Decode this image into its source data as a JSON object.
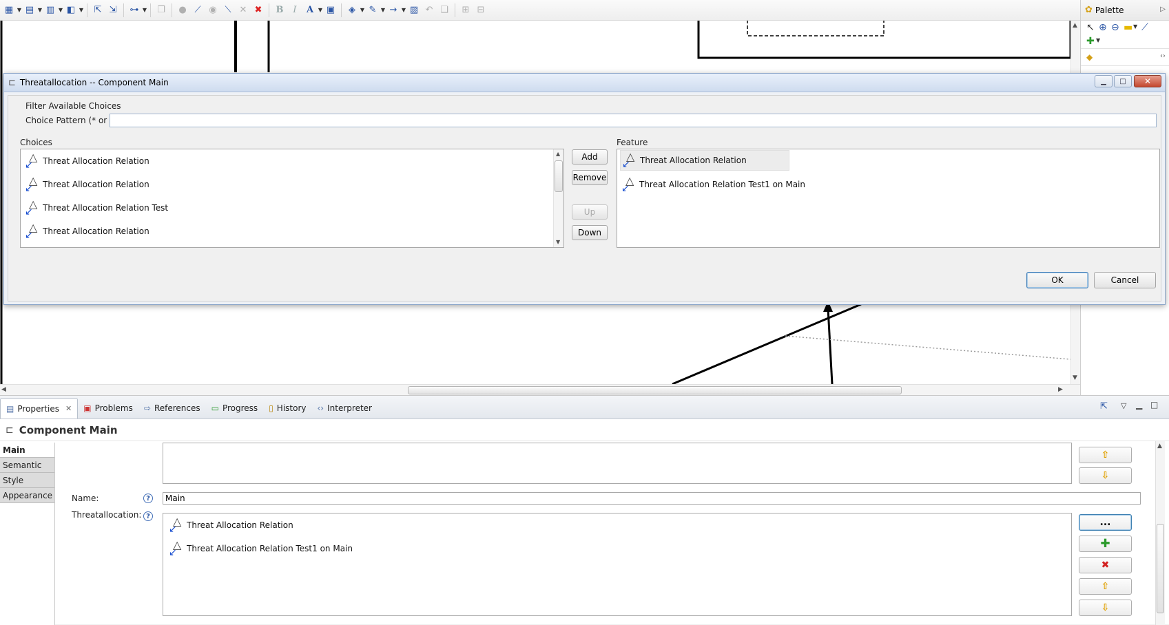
{
  "toolbar": {
    "icons": [
      "align-icon",
      "arrange-icon",
      "distribute-icon",
      "layout-icon",
      "navigate-icon",
      "select-all-icon",
      "route-icon",
      "copy-format-icon",
      "dot-icon",
      "pin-icon",
      "label-icon",
      "label-icon-2",
      "delete-icon",
      "delete-from-model-icon",
      "bold-icon",
      "italic-icon",
      "font-color-icon",
      "text-style-icon",
      "fill-color-icon",
      "line-color-icon",
      "line-style-icon",
      "image-icon",
      "undo-icon",
      "redo-icon",
      "group-icon",
      "ungroup-icon"
    ],
    "bold": "B",
    "italic": "I",
    "font_color": "A"
  },
  "palette": {
    "title": "Palette"
  },
  "dialog": {
    "title": "Threatallocation -- Component Main",
    "filter_group_label": "Filter Available Choices",
    "choice_pattern_label": "Choice Pattern (* or ?)",
    "choice_pattern_value": "",
    "choices_label": "Choices",
    "feature_label": "Feature",
    "choices": [
      "Threat Allocation Relation",
      "Threat Allocation Relation",
      "Threat Allocation Relation Test",
      "Threat Allocation Relation"
    ],
    "features": [
      "Threat Allocation Relation",
      "Threat Allocation Relation Test1 on Main"
    ],
    "buttons": {
      "add": "Add",
      "remove": "Remove",
      "up": "Up",
      "down": "Down",
      "ok": "OK",
      "cancel": "Cancel"
    }
  },
  "properties": {
    "tabs": [
      {
        "label": "Properties",
        "active": true
      },
      {
        "label": "Problems"
      },
      {
        "label": "References"
      },
      {
        "label": "Progress"
      },
      {
        "label": "History"
      },
      {
        "label": "Interpreter"
      }
    ],
    "title": "Component Main",
    "nav": [
      "Main",
      "Semantic",
      "Style",
      "Appearance"
    ],
    "name_label": "Name:",
    "name_value": "Main",
    "threatallocation_label": "Threatallocation:",
    "threatallocation_items": [
      "Threat Allocation Relation",
      "Threat Allocation Relation Test1 on Main"
    ],
    "browse_button": "...",
    "help": "?"
  }
}
